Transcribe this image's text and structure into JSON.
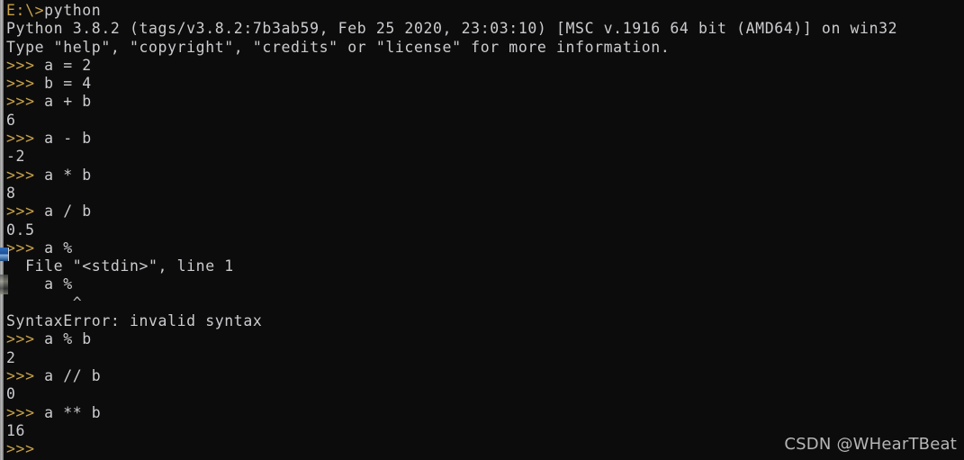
{
  "window": {
    "background_color": "#0c0c0c",
    "foreground_color": "#ccccd0",
    "prompt_color": "#c8a24a"
  },
  "terminal": {
    "lines": [
      {
        "kind": "command",
        "prompt": "E:\\>",
        "text": "python"
      },
      {
        "kind": "output",
        "prompt": "",
        "text": "Python 3.8.2 (tags/v3.8.2:7b3ab59, Feb 25 2020, 23:03:10) [MSC v.1916 64 bit (AMD64)] on win32"
      },
      {
        "kind": "output",
        "prompt": "",
        "text": "Type \"help\", \"copyright\", \"credits\" or \"license\" for more information."
      },
      {
        "kind": "command",
        "prompt": ">>> ",
        "text": "a = 2"
      },
      {
        "kind": "command",
        "prompt": ">>> ",
        "text": "b = 4"
      },
      {
        "kind": "command",
        "prompt": ">>> ",
        "text": "a + b"
      },
      {
        "kind": "output",
        "prompt": "",
        "text": "6"
      },
      {
        "kind": "command",
        "prompt": ">>> ",
        "text": "a - b"
      },
      {
        "kind": "output",
        "prompt": "",
        "text": "-2"
      },
      {
        "kind": "command",
        "prompt": ">>> ",
        "text": "a * b"
      },
      {
        "kind": "output",
        "prompt": "",
        "text": "8"
      },
      {
        "kind": "command",
        "prompt": ">>> ",
        "text": "a / b"
      },
      {
        "kind": "output",
        "prompt": "",
        "text": "0.5"
      },
      {
        "kind": "command",
        "prompt": ">>> ",
        "text": "a %"
      },
      {
        "kind": "output",
        "prompt": "",
        "text": "  File \"<stdin>\", line 1"
      },
      {
        "kind": "output",
        "prompt": "",
        "text": "    a %"
      },
      {
        "kind": "caret",
        "prompt": "",
        "text": "       ^"
      },
      {
        "kind": "output",
        "prompt": "",
        "text": "SyntaxError: invalid syntax"
      },
      {
        "kind": "command",
        "prompt": ">>> ",
        "text": "a % b"
      },
      {
        "kind": "output",
        "prompt": "",
        "text": "2"
      },
      {
        "kind": "command",
        "prompt": ">>> ",
        "text": "a // b"
      },
      {
        "kind": "output",
        "prompt": "",
        "text": "0"
      },
      {
        "kind": "command",
        "prompt": ">>> ",
        "text": "a ** b"
      },
      {
        "kind": "output",
        "prompt": "",
        "text": "16"
      },
      {
        "kind": "command",
        "prompt": ">>> ",
        "text": ""
      }
    ]
  },
  "watermark": {
    "text": "CSDN @WHearTBeat"
  }
}
